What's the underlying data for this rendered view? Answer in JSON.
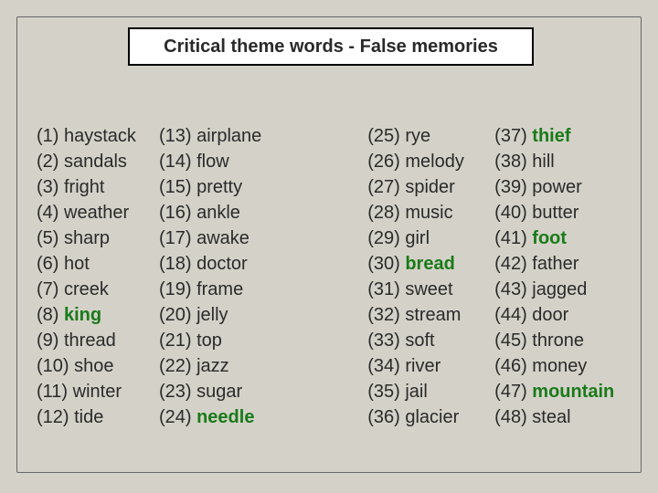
{
  "title": "Critical theme words - False memories",
  "words": [
    {
      "n": 1,
      "w": "haystack",
      "hl": false
    },
    {
      "n": 2,
      "w": "sandals",
      "hl": false
    },
    {
      "n": 3,
      "w": "fright",
      "hl": false
    },
    {
      "n": 4,
      "w": "weather",
      "hl": false
    },
    {
      "n": 5,
      "w": "sharp",
      "hl": false
    },
    {
      "n": 6,
      "w": "hot",
      "hl": false
    },
    {
      "n": 7,
      "w": "creek",
      "hl": false
    },
    {
      "n": 8,
      "w": "king",
      "hl": true
    },
    {
      "n": 9,
      "w": "thread",
      "hl": false
    },
    {
      "n": 10,
      "w": "shoe",
      "hl": false
    },
    {
      "n": 11,
      "w": "winter",
      "hl": false
    },
    {
      "n": 12,
      "w": "tide",
      "hl": false
    },
    {
      "n": 13,
      "w": "airplane",
      "hl": false
    },
    {
      "n": 14,
      "w": "flow",
      "hl": false
    },
    {
      "n": 15,
      "w": "pretty",
      "hl": false
    },
    {
      "n": 16,
      "w": "ankle",
      "hl": false
    },
    {
      "n": 17,
      "w": "awake",
      "hl": false
    },
    {
      "n": 18,
      "w": "doctor",
      "hl": false
    },
    {
      "n": 19,
      "w": "frame",
      "hl": false
    },
    {
      "n": 20,
      "w": "jelly",
      "hl": false
    },
    {
      "n": 21,
      "w": "top",
      "hl": false
    },
    {
      "n": 22,
      "w": "jazz",
      "hl": false
    },
    {
      "n": 23,
      "w": "sugar",
      "hl": false
    },
    {
      "n": 24,
      "w": "needle",
      "hl": true
    },
    {
      "n": 25,
      "w": "rye",
      "hl": false
    },
    {
      "n": 26,
      "w": "melody",
      "hl": false
    },
    {
      "n": 27,
      "w": "spider",
      "hl": false
    },
    {
      "n": 28,
      "w": "music",
      "hl": false
    },
    {
      "n": 29,
      "w": "girl",
      "hl": false
    },
    {
      "n": 30,
      "w": "bread",
      "hl": true
    },
    {
      "n": 31,
      "w": "sweet",
      "hl": false
    },
    {
      "n": 32,
      "w": "stream",
      "hl": false
    },
    {
      "n": 33,
      "w": "soft",
      "hl": false
    },
    {
      "n": 34,
      "w": "river",
      "hl": false
    },
    {
      "n": 35,
      "w": "jail",
      "hl": false
    },
    {
      "n": 36,
      "w": "glacier",
      "hl": false
    },
    {
      "n": 37,
      "w": "thief",
      "hl": true
    },
    {
      "n": 38,
      "w": "hill",
      "hl": false
    },
    {
      "n": 39,
      "w": "power",
      "hl": false
    },
    {
      "n": 40,
      "w": "butter",
      "hl": false
    },
    {
      "n": 41,
      "w": "foot",
      "hl": true
    },
    {
      "n": 42,
      "w": "father",
      "hl": false
    },
    {
      "n": 43,
      "w": "jagged",
      "hl": false
    },
    {
      "n": 44,
      "w": "door",
      "hl": false
    },
    {
      "n": 45,
      "w": "throne",
      "hl": false
    },
    {
      "n": 46,
      "w": "money",
      "hl": false
    },
    {
      "n": 47,
      "w": "mountain",
      "hl": true
    },
    {
      "n": 48,
      "w": "steal",
      "hl": false
    }
  ],
  "columns_per_block": 12
}
